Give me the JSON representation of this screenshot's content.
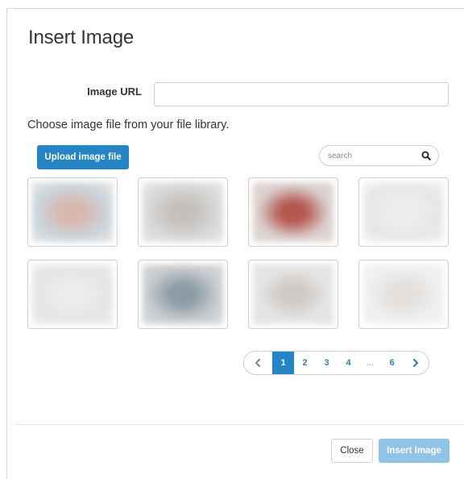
{
  "dialog": {
    "title": "Insert Image",
    "image_url_label": "Image URL",
    "image_url_value": "",
    "library_text": "Choose image file from your file library."
  },
  "toolbar": {
    "upload_label": "Upload image file",
    "search_placeholder": "search",
    "search_icon": "search-icon"
  },
  "thumbnails": [
    {
      "name": "library-image-1",
      "colors": [
        "#c9d5de",
        "#d9b8ae",
        "#e8e4e0"
      ]
    },
    {
      "name": "library-image-2",
      "colors": [
        "#d8d8d8",
        "#c4c0bc",
        "#e4e6ea"
      ]
    },
    {
      "name": "library-image-3",
      "colors": [
        "#d9cfcc",
        "#b5574f",
        "#e2dad6"
      ]
    },
    {
      "name": "library-image-4",
      "colors": [
        "#e6e6e6",
        "#eeeeee",
        "#f2f2f2"
      ]
    },
    {
      "name": "library-image-5",
      "colors": [
        "#e4e4e4",
        "#ededed",
        "#ececec"
      ]
    },
    {
      "name": "library-image-6",
      "colors": [
        "#c8cbcf",
        "#8c9ba6",
        "#d7d9da"
      ]
    },
    {
      "name": "library-image-7",
      "colors": [
        "#e6e6e6",
        "#cfcac6",
        "#e3e0dd"
      ]
    },
    {
      "name": "library-image-8",
      "colors": [
        "#efefef",
        "#e3e0dd",
        "#f3f3f3"
      ]
    }
  ],
  "pagination": {
    "prev_icon": "chevron-left-icon",
    "next_icon": "chevron-right-icon",
    "pages": [
      "1",
      "2",
      "3",
      "4",
      "...",
      "6"
    ],
    "current": "1"
  },
  "footer": {
    "close_label": "Close",
    "insert_label": "Insert Image"
  },
  "colors": {
    "primary": "#2384c6",
    "primary_disabled": "#8fc3e7",
    "border": "#cfcfcf",
    "text": "#333333"
  }
}
